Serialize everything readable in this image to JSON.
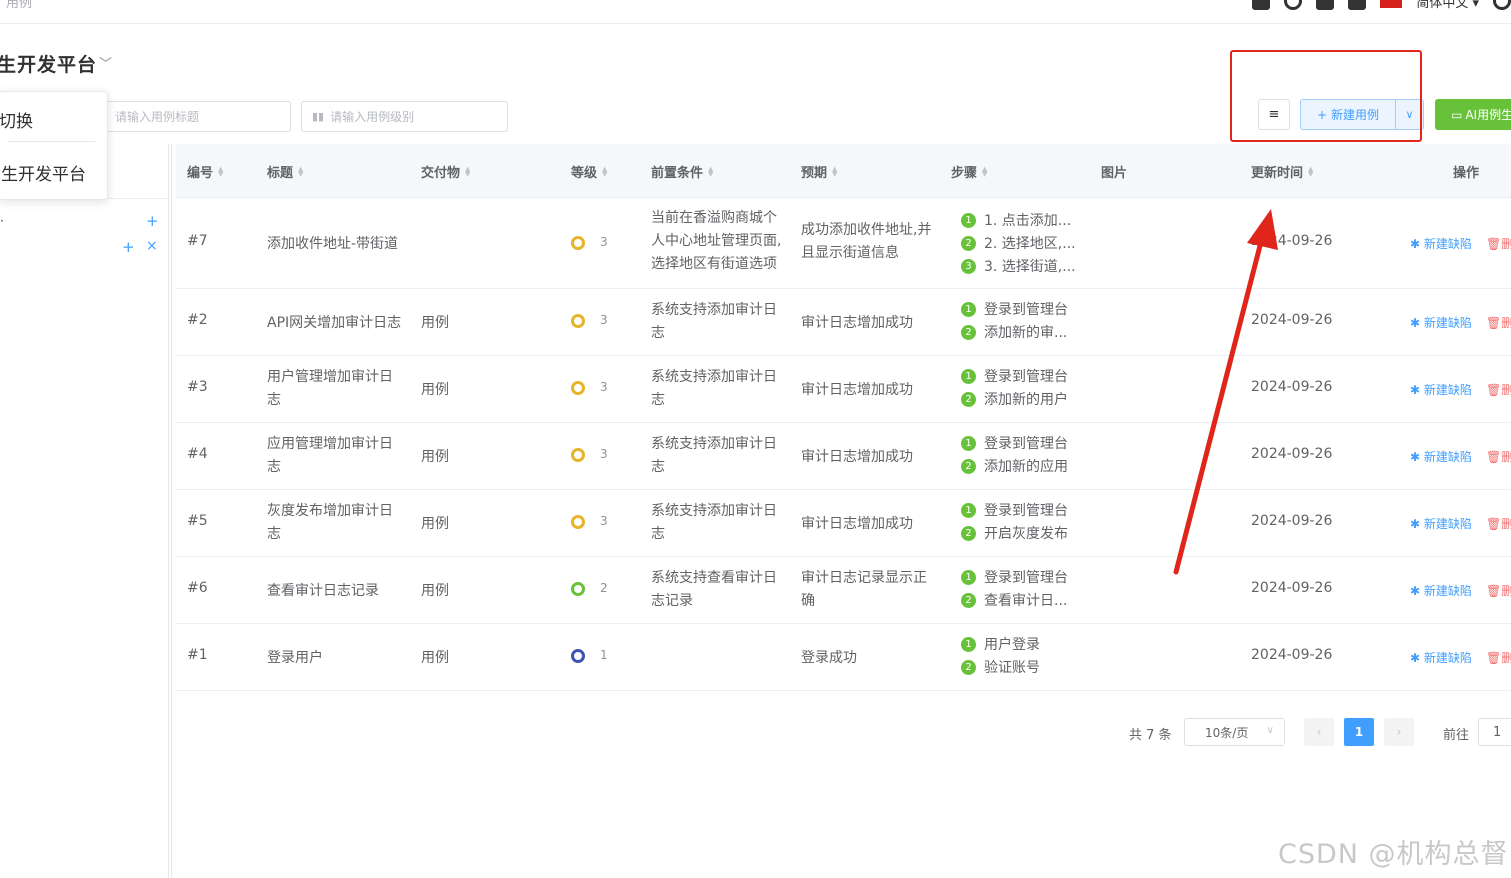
{
  "topbar": {
    "breadcrumb": "用例",
    "language": "简体中文 ▾"
  },
  "project": {
    "title": "生开发平台",
    "caret": "﹀"
  },
  "popup": {
    "switch_label": "切换",
    "project_label": "生开发平台"
  },
  "search": {
    "title_placeholder": "请输入用例标题",
    "level_placeholder": "请输入用例级别"
  },
  "tree": {
    "dot": "·",
    "plus": "+",
    "close": "×"
  },
  "toolbar": {
    "menu_glyph": "≡",
    "new_case": "新建用例",
    "dropdown_glyph": "∨",
    "ai_case": "AI用例生"
  },
  "table": {
    "headers": [
      "编号",
      "标题",
      "交付物",
      "等级",
      "前置条件",
      "预期",
      "步骤",
      "图片",
      "更新时间",
      "操作"
    ],
    "rows": [
      {
        "id": "#7",
        "title": "添加收件地址-带街道",
        "deliverable": "",
        "level": "3",
        "level_color": "#e6b32a",
        "precondition": "当前在香溢购商城个人中心地址管理页面,选择地区有街道选项",
        "expected": "成功添加收件地址,并且显示街道信息",
        "steps": [
          "1. 点击添加...",
          "2. 选择地区,...",
          "3. 选择街道,..."
        ],
        "updated": "2024-09-26"
      },
      {
        "id": "#2",
        "title": "API网关增加审计日志",
        "deliverable": "用例",
        "level": "3",
        "level_color": "#e6b32a",
        "precondition": "系统支持添加审计日志",
        "expected": "审计日志增加成功",
        "steps": [
          "登录到管理台",
          "添加新的审..."
        ],
        "updated": "2024-09-26"
      },
      {
        "id": "#3",
        "title": "用户管理增加审计日志",
        "deliverable": "用例",
        "level": "3",
        "level_color": "#e6b32a",
        "precondition": "系统支持添加审计日志",
        "expected": "审计日志增加成功",
        "steps": [
          "登录到管理台",
          "添加新的用户"
        ],
        "updated": "2024-09-26"
      },
      {
        "id": "#4",
        "title": "应用管理增加审计日志",
        "deliverable": "用例",
        "level": "3",
        "level_color": "#e6b32a",
        "precondition": "系统支持添加审计日志",
        "expected": "审计日志增加成功",
        "steps": [
          "登录到管理台",
          "添加新的应用"
        ],
        "updated": "2024-09-26"
      },
      {
        "id": "#5",
        "title": "灰度发布增加审计日志",
        "deliverable": "用例",
        "level": "3",
        "level_color": "#e6b32a",
        "precondition": "系统支持添加审计日志",
        "expected": "审计日志增加成功",
        "steps": [
          "登录到管理台",
          "开启灰度发布"
        ],
        "updated": "2024-09-26"
      },
      {
        "id": "#6",
        "title": "查看审计日志记录",
        "deliverable": "用例",
        "level": "2",
        "level_color": "#67c23a",
        "precondition": "系统支持查看审计日志记录",
        "expected": "审计日志记录显示正确",
        "steps": [
          "登录到管理台",
          "查看审计日..."
        ],
        "updated": "2024-09-26"
      },
      {
        "id": "#1",
        "title": "登录用户",
        "deliverable": "用例",
        "level": "1",
        "level_color": "#3f51b5",
        "precondition": "",
        "expected": "登录成功",
        "steps": [
          "用户登录",
          "验证账号"
        ],
        "updated": "2024-09-26"
      }
    ],
    "action_bug": "新建缺陷",
    "action_delete": "删除"
  },
  "pagination": {
    "total": "共 7 条",
    "page_size": "10条/页",
    "current": "1",
    "goto_label": "前往",
    "goto_value": "1",
    "prev": "‹",
    "next": "›"
  },
  "watermark": "CSDN @机构总督",
  "colors": {
    "accent": "#409eff",
    "success": "#67c23a",
    "danger": "#f56c6c",
    "annotation": "#e0251b"
  }
}
